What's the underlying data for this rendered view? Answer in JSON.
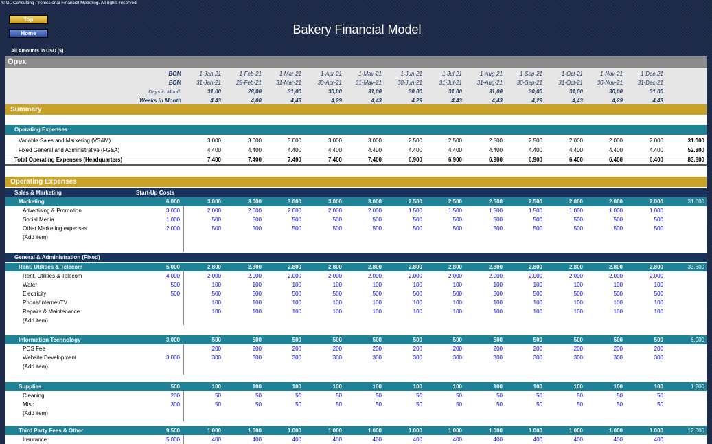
{
  "copyright": "© GL Consulting-Professional Financial Modeling. All rights reserved.",
  "nav": {
    "top": "Top",
    "home": "Home"
  },
  "title": "Bakery Financial Model",
  "amounts_label": "All Amounts in  USD ($)",
  "sheet": {
    "opex": "Opex",
    "header_labels": {
      "bom": "BOM",
      "eom": "EOM",
      "days": "Days in Month",
      "weeks": "Weeks in Month"
    },
    "bom": [
      "1-Jan-21",
      "1-Feb-21",
      "1-Mar-21",
      "1-Apr-21",
      "1-May-21",
      "1-Jun-21",
      "1-Jul-21",
      "1-Aug-21",
      "1-Sep-21",
      "1-Oct-21",
      "1-Nov-21",
      "1-Dec-21"
    ],
    "eom": [
      "31-Jan-21",
      "28-Feb-21",
      "31-Mar-21",
      "30-Apr-21",
      "31-May-21",
      "30-Jun-21",
      "31-Jul-21",
      "31-Aug-21",
      "30-Sep-21",
      "31-Oct-21",
      "30-Nov-21",
      "31-Dec-21"
    ],
    "days": [
      "31,00",
      "28,00",
      "31,00",
      "30,00",
      "31,00",
      "30,00",
      "31,00",
      "31,00",
      "30,00",
      "31,00",
      "30,00",
      "31,00"
    ],
    "weeks": [
      "4,43",
      "4,00",
      "4,43",
      "4,29",
      "4,43",
      "4,29",
      "4,43",
      "4,43",
      "4,29",
      "4,43",
      "4,29",
      "4,43"
    ],
    "summary_title": "Summary",
    "summary": {
      "header": "Operating Expenses",
      "rows": [
        {
          "label": "Variable Sales and Marketing (VS&M)",
          "values": [
            "3.000",
            "3.000",
            "3.000",
            "3.000",
            "3.000",
            "2.500",
            "2.500",
            "2.500",
            "2.500",
            "2.000",
            "2.000",
            "2.000"
          ],
          "total": "31.000"
        },
        {
          "label": "Fixed General and Administrative (FG&A)",
          "values": [
            "4.400",
            "4.400",
            "4.400",
            "4.400",
            "4.400",
            "4.400",
            "4.400",
            "4.400",
            "4.400",
            "4.400",
            "4.400",
            "4.400"
          ],
          "total": "52.800"
        }
      ],
      "total": {
        "label": "Total Operating Expenses (Headquarters)",
        "values": [
          "7.400",
          "7.400",
          "7.400",
          "7.400",
          "7.400",
          "6.900",
          "6.900",
          "6.900",
          "6.900",
          "6.400",
          "6.400",
          "6.400"
        ],
        "total": "83.800"
      }
    },
    "opex_title": "Operating Expenses",
    "sm_header": {
      "label": "Sales & Marketing",
      "startup": "Start-Up Costs"
    },
    "marketing": {
      "label": "Marketing",
      "startup": "6.000",
      "values": [
        "3.000",
        "3.000",
        "3.000",
        "3.000",
        "3.000",
        "2.500",
        "2.500",
        "2.500",
        "2.500",
        "2.000",
        "2.000",
        "2.000"
      ],
      "total": "31.000",
      "items": [
        {
          "label": "Advertising & Promotion",
          "startup": "3.000",
          "values": [
            "2.000",
            "2.000",
            "2.000",
            "2.000",
            "2.000",
            "1.500",
            "1.500",
            "1.500",
            "1.500",
            "1.000",
            "1.000",
            "1.000"
          ]
        },
        {
          "label": "Social Media",
          "startup": "1.000",
          "values": [
            "500",
            "500",
            "500",
            "500",
            "500",
            "500",
            "500",
            "500",
            "500",
            "500",
            "500",
            "500"
          ]
        },
        {
          "label": "Other Marketing expenses",
          "startup": "2.000",
          "values": [
            "500",
            "500",
            "500",
            "500",
            "500",
            "500",
            "500",
            "500",
            "500",
            "500",
            "500",
            "500"
          ]
        },
        {
          "label": "(Add item)",
          "startup": "",
          "values": []
        }
      ]
    },
    "ga_header": "General & Administration (Fixed)",
    "rent": {
      "label": "Rent, Utilities & Telecom",
      "startup": "5.000",
      "values": [
        "2.800",
        "2.800",
        "2.800",
        "2.800",
        "2.800",
        "2.800",
        "2.800",
        "2.800",
        "2.800",
        "2.800",
        "2.800",
        "2.800"
      ],
      "total": "33.600",
      "items": [
        {
          "label": "Rent, Utilities & Telecom",
          "startup": "4.000",
          "values": [
            "2.000",
            "2.000",
            "2.000",
            "2.000",
            "2.000",
            "2.000",
            "2.000",
            "2.000",
            "2.000",
            "2.000",
            "2.000",
            "2.000"
          ]
        },
        {
          "label": "Water",
          "startup": "500",
          "values": [
            "100",
            "100",
            "100",
            "100",
            "100",
            "100",
            "100",
            "100",
            "100",
            "100",
            "100",
            "100"
          ]
        },
        {
          "label": "Electricity",
          "startup": "500",
          "values": [
            "500",
            "500",
            "500",
            "500",
            "500",
            "500",
            "500",
            "500",
            "500",
            "500",
            "500",
            "500"
          ]
        },
        {
          "label": "Phone/Internet/TV",
          "startup": "",
          "values": [
            "100",
            "100",
            "100",
            "100",
            "100",
            "100",
            "100",
            "100",
            "100",
            "100",
            "100",
            "100"
          ]
        },
        {
          "label": "Repairs & Maintenance",
          "startup": "",
          "values": [
            "100",
            "100",
            "100",
            "100",
            "100",
            "100",
            "100",
            "100",
            "100",
            "100",
            "100",
            "100"
          ]
        },
        {
          "label": "(Add item)",
          "startup": "",
          "values": []
        }
      ]
    },
    "it": {
      "label": "Information Technology",
      "startup": "3.000",
      "values": [
        "500",
        "500",
        "500",
        "500",
        "500",
        "500",
        "500",
        "500",
        "500",
        "500",
        "500",
        "500"
      ],
      "total": "6.000",
      "items": [
        {
          "label": "POS Fee",
          "startup": "",
          "values": [
            "200",
            "200",
            "200",
            "200",
            "200",
            "200",
            "200",
            "200",
            "200",
            "200",
            "200",
            "200"
          ]
        },
        {
          "label": "Website Development",
          "startup": "3.000",
          "values": [
            "300",
            "300",
            "300",
            "300",
            "300",
            "300",
            "300",
            "300",
            "300",
            "300",
            "300",
            "300"
          ]
        },
        {
          "label": "(Add item)",
          "startup": "",
          "values": []
        }
      ]
    },
    "supplies": {
      "label": "Supplies",
      "startup": "500",
      "values": [
        "100",
        "100",
        "100",
        "100",
        "100",
        "100",
        "100",
        "100",
        "100",
        "100",
        "100",
        "100"
      ],
      "total": "1.200",
      "items": [
        {
          "label": "Cleaning",
          "startup": "200",
          "values": [
            "50",
            "50",
            "50",
            "50",
            "50",
            "50",
            "50",
            "50",
            "50",
            "50",
            "50",
            "50"
          ]
        },
        {
          "label": "Misc",
          "startup": "300",
          "values": [
            "50",
            "50",
            "50",
            "50",
            "50",
            "50",
            "50",
            "50",
            "50",
            "50",
            "50",
            "50"
          ]
        },
        {
          "label": "(Add item)",
          "startup": "",
          "values": []
        }
      ]
    },
    "third_party": {
      "label": "Third Party Fees & Other",
      "startup": "9.500",
      "values": [
        "1.000",
        "1.000",
        "1.000",
        "1.000",
        "1.000",
        "1.000",
        "1.000",
        "1.000",
        "1.000",
        "1.000",
        "1.000",
        "1.000"
      ],
      "total": "12.000",
      "items": [
        {
          "label": "Insurance",
          "startup": "5.000",
          "values": [
            "400",
            "400",
            "400",
            "400",
            "400",
            "400",
            "400",
            "400",
            "400",
            "400",
            "400",
            "400"
          ]
        }
      ]
    }
  }
}
